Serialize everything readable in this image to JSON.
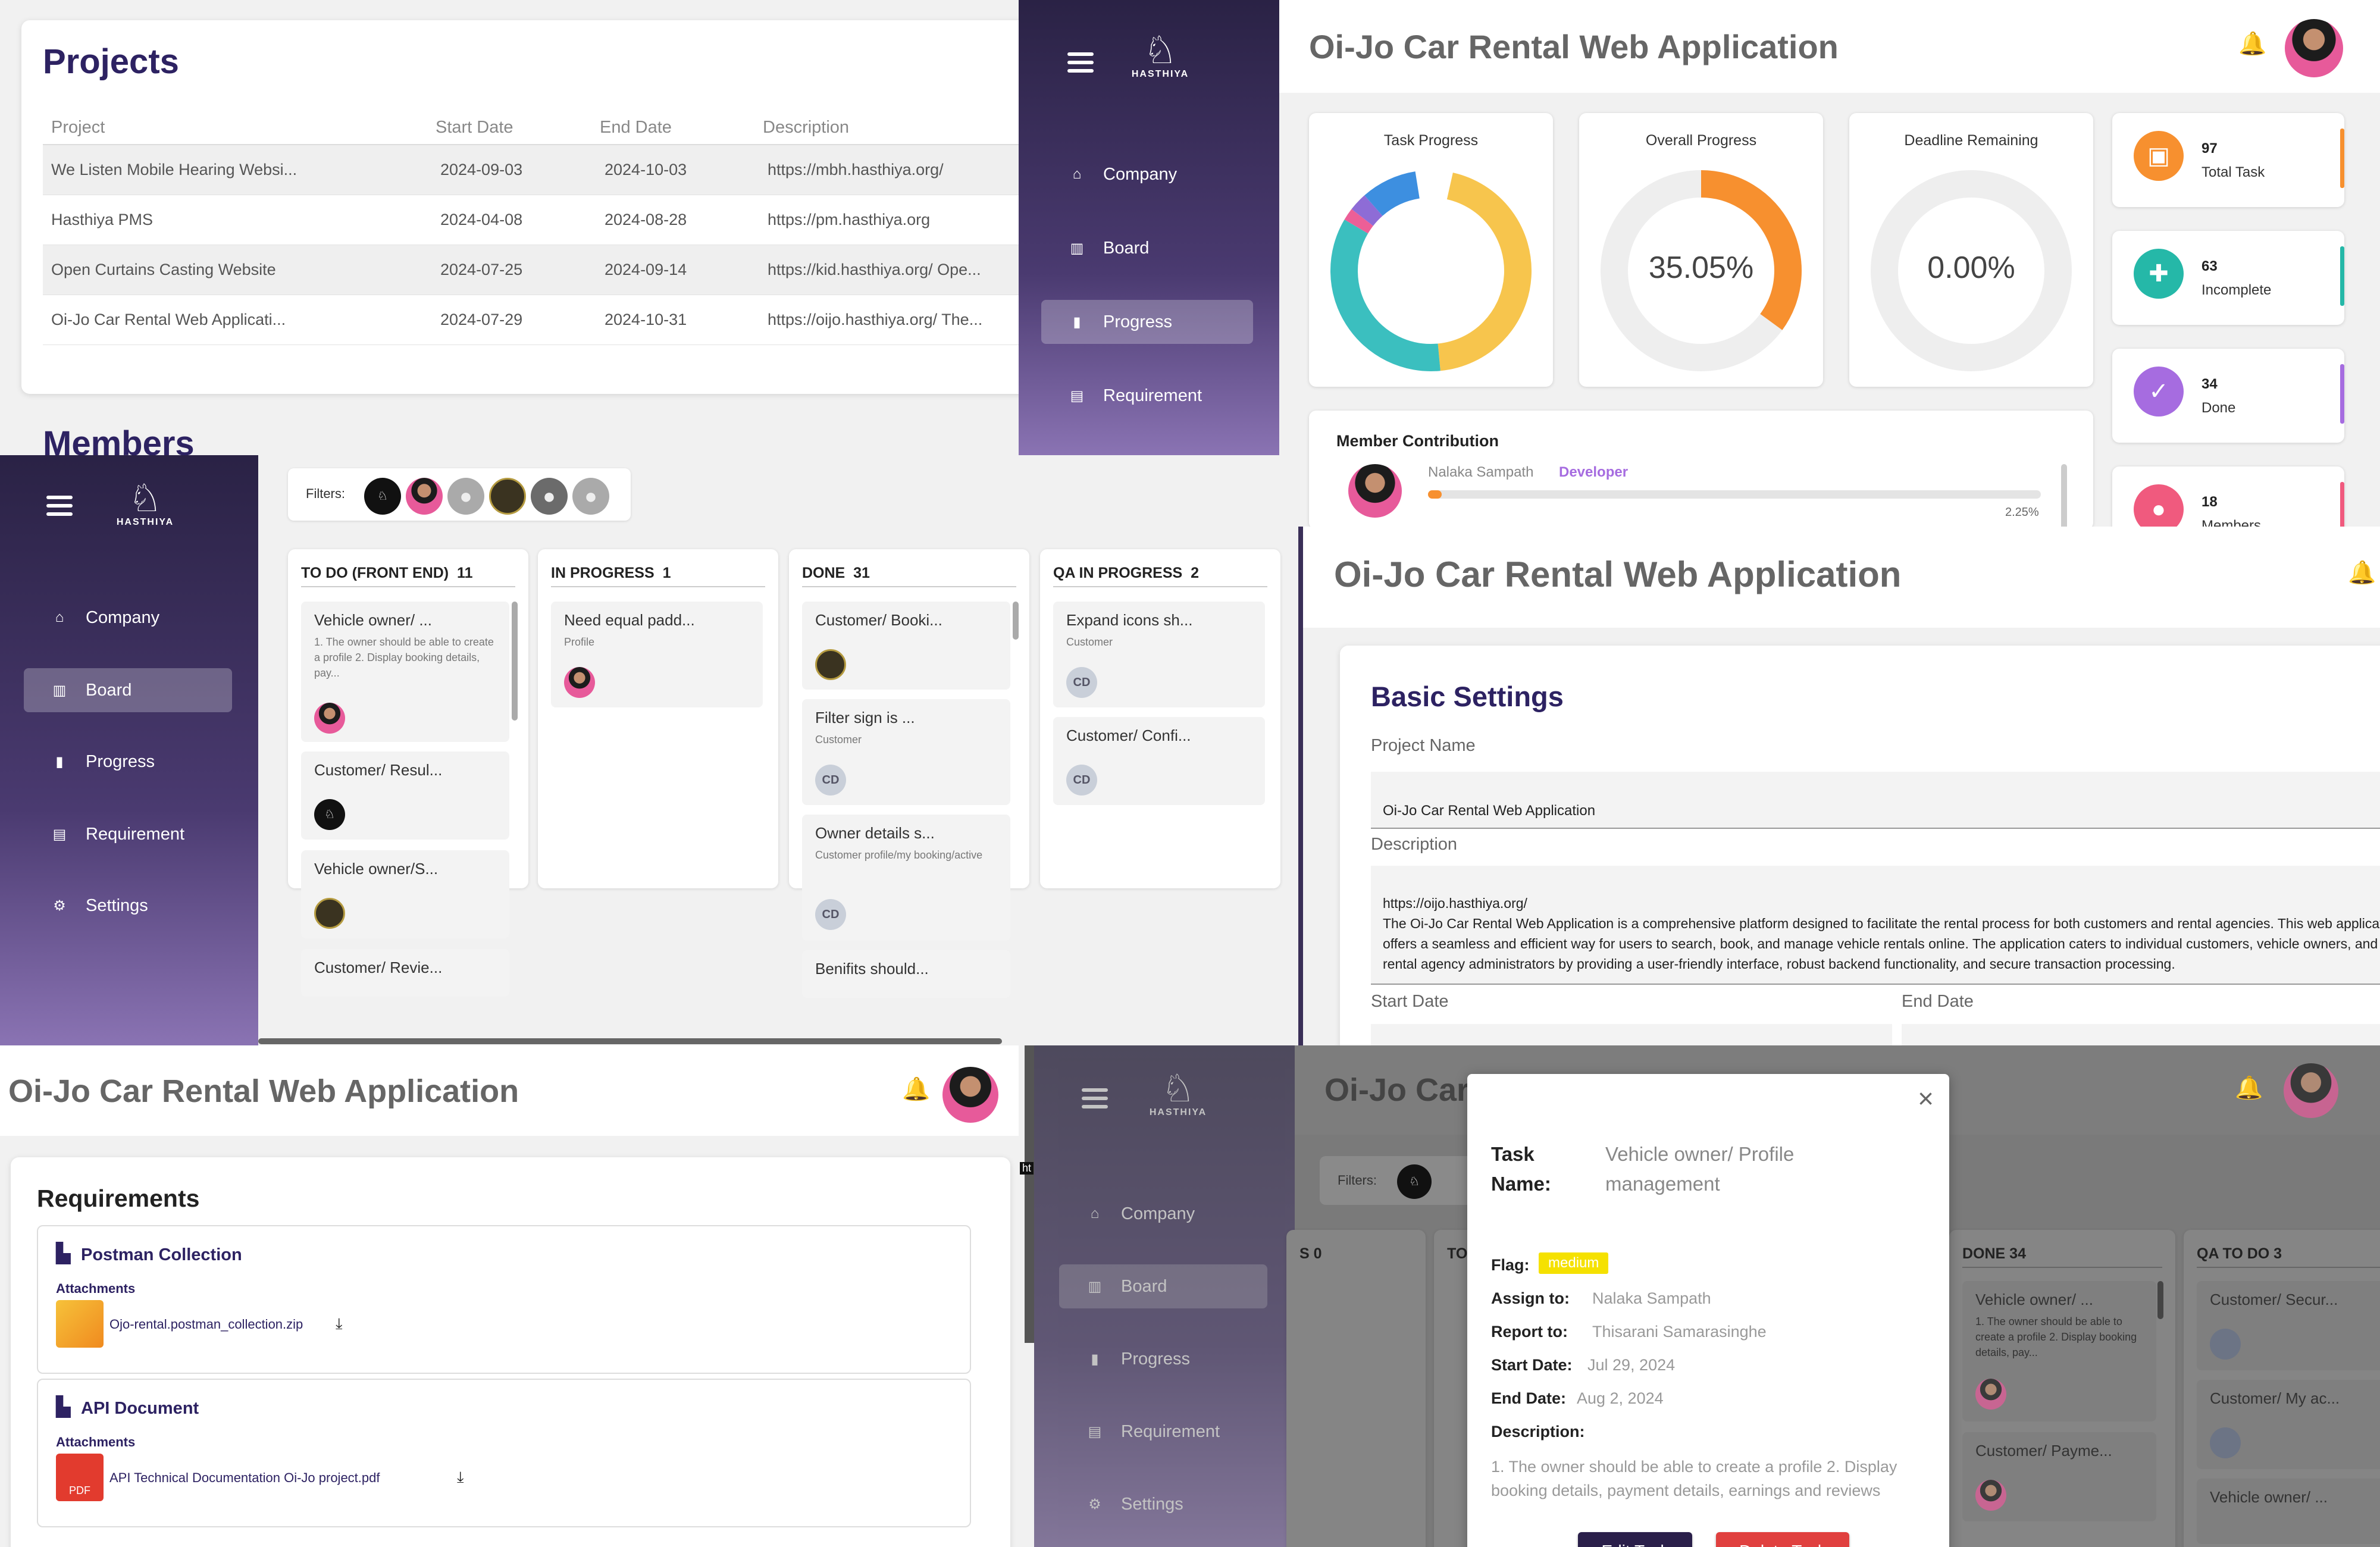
{
  "app_title": "Oi-Jo Car Rental Web Application",
  "nav": {
    "company": "Company",
    "board": "Board",
    "progress": "Progress",
    "requirement": "Requirement",
    "settings": "Settings"
  },
  "logo_text": "HASTHIYA",
  "projects": {
    "title": "Projects",
    "headers": [
      "Project",
      "Start Date",
      "End Date",
      "Description"
    ],
    "rows": [
      {
        "project": "We Listen Mobile Hearing Websi...",
        "start": "2024-09-03",
        "end": "2024-10-03",
        "desc": "https://mbh.hasthiya.org/"
      },
      {
        "project": "Hasthiya PMS",
        "start": "2024-04-08",
        "end": "2024-08-28",
        "desc": "https://pm.hasthiya.org"
      },
      {
        "project": "Open Curtains Casting Website",
        "start": "2024-07-25",
        "end": "2024-09-14",
        "desc": "https://kid.hasthiya.org/ Ope..."
      },
      {
        "project": "Oi-Jo Car Rental Web Applicati...",
        "start": "2024-07-29",
        "end": "2024-10-31",
        "desc": "https://oijo.hasthiya.org/ The..."
      }
    ],
    "members_title": "Members"
  },
  "progress": {
    "task_progress": "Task Progress",
    "overall_progress": "Overall Progress",
    "overall_value": "35.05%",
    "deadline_remaining": "Deadline Remaining",
    "deadline_value": "0.00%",
    "donut_colors": [
      "#f7c54d",
      "#3bbfbf",
      "#ec5f97",
      "#8e6cd6",
      "#3d8fe0"
    ],
    "donut_fractions": [
      0.45,
      0.35,
      0.02,
      0.03,
      0.09
    ],
    "overall_fraction": 0.3505,
    "deadline_fraction": 0.0,
    "stats": [
      {
        "num": "97",
        "label": "Total Task",
        "color": "#f7902f",
        "icon": "clipboard-icon"
      },
      {
        "num": "63",
        "label": "Incomplete",
        "color": "#25b8a8",
        "icon": "clipboard-plus-icon"
      },
      {
        "num": "34",
        "label": "Done",
        "color": "#a66ce0",
        "icon": "check-icon"
      },
      {
        "num": "18",
        "label": "Members",
        "color": "#f05a7e",
        "icon": "group-icon"
      }
    ],
    "member_contribution": "Member Contribution",
    "member_name": "Nalaka Sampath",
    "member_role": "Developer",
    "member_pct": "2.25%",
    "member_fraction": 0.0225
  },
  "board": {
    "filters_label": "Filters:",
    "columns": [
      {
        "title": "TO DO (FRONT END)",
        "count": "11",
        "tasks": [
          {
            "title": "Vehicle owner/ ...",
            "sub": "1. The owner should be able to create a profile 2. Display booking details, pay..."
          },
          {
            "title": "Customer/ Resul...",
            "sub": ""
          },
          {
            "title": "Vehicle owner/S...",
            "sub": ""
          },
          {
            "title": "Customer/ Revie...",
            "sub": ""
          }
        ]
      },
      {
        "title": "IN PROGRESS",
        "count": "1",
        "tasks": [
          {
            "title": "Need equal padd...",
            "sub": "Profile"
          }
        ]
      },
      {
        "title": "DONE",
        "count": "31",
        "tasks": [
          {
            "title": "Customer/ Booki...",
            "sub": ""
          },
          {
            "title": "Filter sign is ...",
            "sub": "Customer"
          },
          {
            "title": "Owner details s...",
            "sub": "Customer profile/my booking/active"
          },
          {
            "title": "Benifits should...",
            "sub": ""
          }
        ]
      },
      {
        "title": "QA IN PROGRESS",
        "count": "2",
        "tasks": [
          {
            "title": "Expand icons sh...",
            "sub": "Customer"
          },
          {
            "title": "Customer/ Confi...",
            "sub": ""
          }
        ]
      }
    ],
    "cd": "CD"
  },
  "settings": {
    "title": "Basic Settings",
    "project_name_label": "Project Name",
    "project_name_value": "Oi-Jo Car Rental Web Application",
    "description_label": "Description",
    "description_url": "https://oijo.hasthiya.org/",
    "description_text": "The Oi-Jo Car Rental Web Application is a comprehensive platform designed to facilitate the rental process for both customers and rental agencies. This web application offers a seamless and efficient way for users to search, book, and manage vehicle rentals online. The application caters to individual customers, vehicle owners, and rental agency administrators by providing a user-friendly interface, robust backend functionality, and secure transaction processing.",
    "start_date_label": "Start Date",
    "end_date_label": "End Date"
  },
  "requirements": {
    "title": "Requirements",
    "items": [
      {
        "name": "Postman Collection",
        "attach_label": "Attachments",
        "file": "Ojo-rental.postman_collection.zip"
      },
      {
        "name": "API Document",
        "attach_label": "Attachments",
        "file": "API Technical Documentation Oi-Jo project.pdf"
      }
    ],
    "pdf_label": "PDF"
  },
  "modal": {
    "header_title": "Oi-Jo Car",
    "task_name_label": "Task Name:",
    "task_name_value": "Vehicle owner/ Profile management",
    "flag_label": "Flag:",
    "flag_value": "medium",
    "assign_label": "Assign to:",
    "assign_value": "Nalaka Sampath",
    "report_label": "Report to:",
    "report_value": "Thisarani Samarasinghe",
    "start_label": "Start Date:",
    "start_value": "Jul 29, 2024",
    "end_label": "End Date:",
    "end_value": "Aug 2, 2024",
    "desc_label": "Description:",
    "desc_value": "1. The owner should be able to create a profile 2. Display booking details, payment details, earnings and reviews",
    "edit_btn": "Edit Task",
    "delete_btn": "Delete Task",
    "close": "×",
    "bg_filters": "Filters:",
    "bg_cols": [
      {
        "title": "S 0"
      },
      {
        "title": "TO"
      },
      {
        "title": "DONE  34"
      },
      {
        "title": "QA TO DO  3"
      }
    ],
    "bg_done_tasks": [
      {
        "title": "Vehicle owner/ ...",
        "sub": "1. The owner should be able to create a profile 2. Display booking details, pay..."
      },
      {
        "title": "Customer/ Payme...",
        "sub": ""
      }
    ],
    "bg_qa_tasks": [
      {
        "title": "Customer/ Secur..."
      },
      {
        "title": "Customer/ My ac..."
      },
      {
        "title": "Vehicle owner/ ..."
      }
    ],
    "ht": "ht"
  }
}
